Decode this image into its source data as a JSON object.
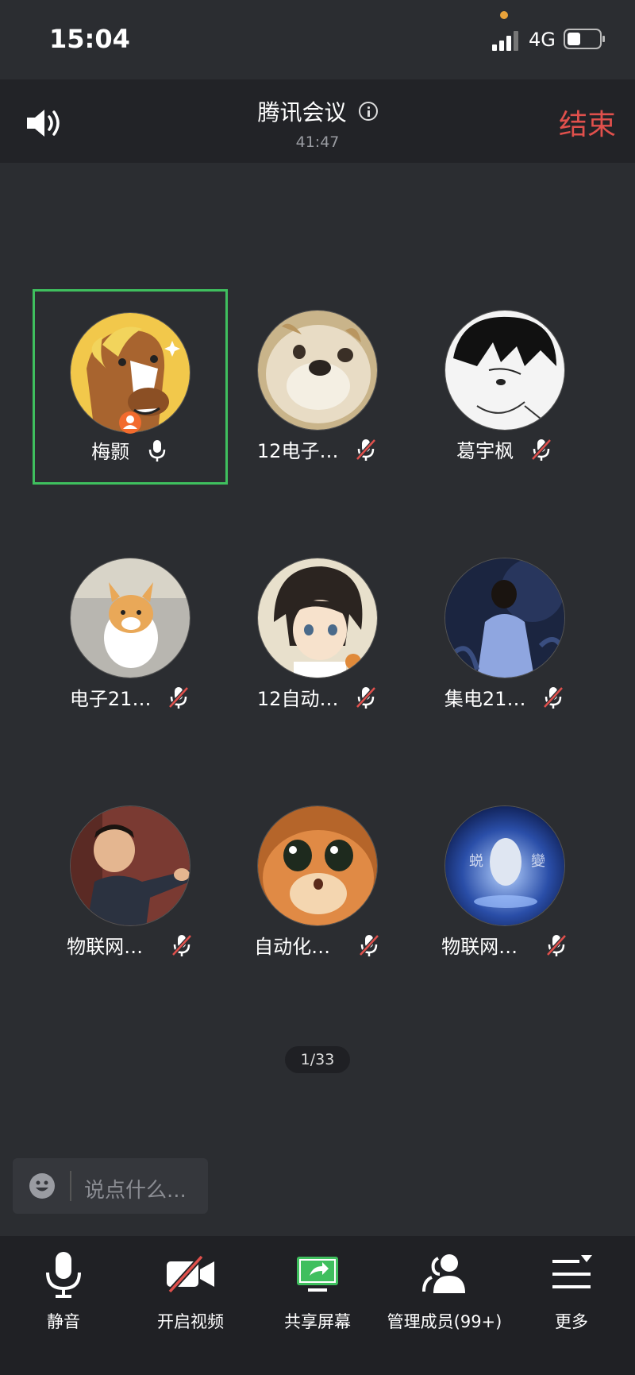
{
  "status_bar": {
    "time": "15:04",
    "network": "4G"
  },
  "header": {
    "title": "腾讯会议",
    "duration": "41:47",
    "end_label": "结束"
  },
  "participants": [
    {
      "name": "梅颢",
      "mic": "on",
      "active": true,
      "host": true,
      "avatar": "horse-cartoon"
    },
    {
      "name": "12电子…",
      "mic": "muted",
      "avatar": "dog-face"
    },
    {
      "name": "葛宇枫",
      "mic": "muted",
      "avatar": "manga-boy"
    },
    {
      "name": "电子21…",
      "mic": "muted",
      "avatar": "corgi"
    },
    {
      "name": "12自动…",
      "mic": "muted",
      "avatar": "anime-girl"
    },
    {
      "name": "集电21…",
      "mic": "muted",
      "avatar": "night-portrait"
    },
    {
      "name": "物联网2…",
      "mic": "muted",
      "avatar": "pointing-man"
    },
    {
      "name": "自动化2…",
      "mic": "muted",
      "avatar": "cat-face"
    },
    {
      "name": "物联网2…",
      "mic": "muted",
      "avatar": "crystal-egg",
      "avatar_text": [
        "蜕",
        "變"
      ]
    }
  ],
  "page_indicator": "1/33",
  "chat": {
    "placeholder": "说点什么..."
  },
  "toolbar": [
    {
      "label": "静音",
      "icon": "microphone-icon"
    },
    {
      "label": "开启视频",
      "icon": "video-off-icon"
    },
    {
      "label": "共享屏幕",
      "icon": "share-screen-icon"
    },
    {
      "label": "管理成员(99+)",
      "icon": "members-icon"
    },
    {
      "label": "更多",
      "icon": "more-icon"
    }
  ],
  "colors": {
    "end": "#e0504c",
    "active_border": "#3fbf5e",
    "share_green": "#3fbf5e",
    "host_badge": "#f26b2d"
  }
}
